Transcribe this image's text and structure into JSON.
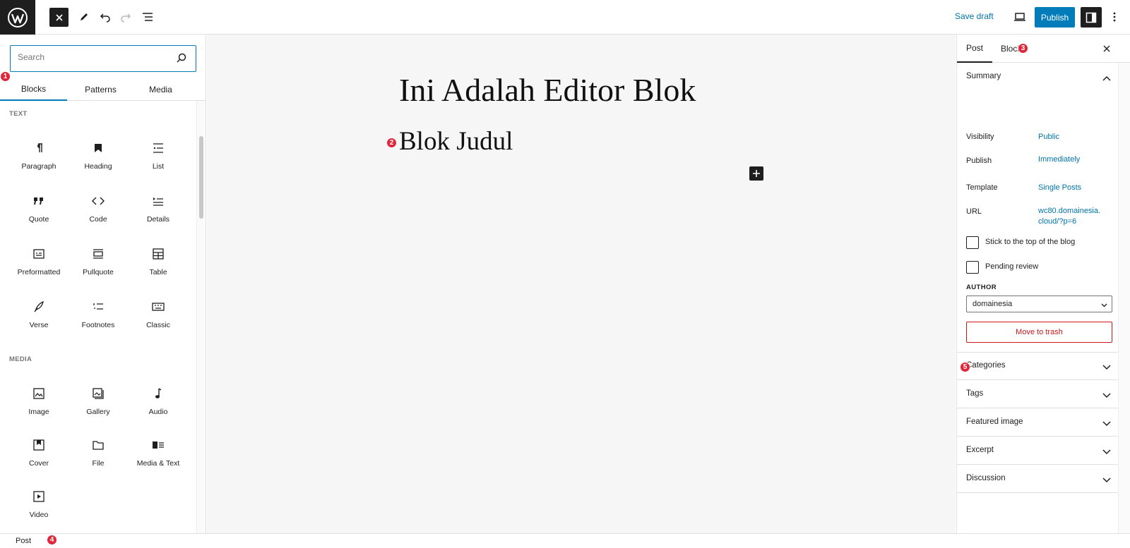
{
  "toolbar": {
    "save_draft": "Save draft",
    "publish": "Publish"
  },
  "inserter": {
    "search_placeholder": "Search",
    "tabs": [
      "Blocks",
      "Patterns",
      "Media"
    ],
    "categories": {
      "text": "TEXT",
      "media": "MEDIA"
    },
    "text_blocks": [
      {
        "label": "Paragraph",
        "icon": "paragraph-icon"
      },
      {
        "label": "Heading",
        "icon": "bookmark-icon"
      },
      {
        "label": "List",
        "icon": "list-icon"
      },
      {
        "label": "Quote",
        "icon": "quote-icon"
      },
      {
        "label": "Code",
        "icon": "code-icon"
      },
      {
        "label": "Details",
        "icon": "details-icon"
      },
      {
        "label": "Preformatted",
        "icon": "preformatted-icon"
      },
      {
        "label": "Pullquote",
        "icon": "pullquote-icon"
      },
      {
        "label": "Table",
        "icon": "table-icon"
      },
      {
        "label": "Verse",
        "icon": "feather-icon"
      },
      {
        "label": "Footnotes",
        "icon": "footnotes-icon"
      },
      {
        "label": "Classic",
        "icon": "keyboard-icon"
      }
    ],
    "media_blocks": [
      {
        "label": "Image",
        "icon": "image-icon"
      },
      {
        "label": "Gallery",
        "icon": "gallery-icon"
      },
      {
        "label": "Audio",
        "icon": "audio-icon"
      },
      {
        "label": "Cover",
        "icon": "cover-icon"
      },
      {
        "label": "File",
        "icon": "folder-icon"
      },
      {
        "label": "Media & Text",
        "icon": "media-text-icon"
      },
      {
        "label": "Video",
        "icon": "video-icon"
      }
    ]
  },
  "editor": {
    "post_title": "Ini Adalah Editor Blok",
    "heading_block": "Blok Judul"
  },
  "sidebar": {
    "tabs": [
      "Post",
      "Block"
    ],
    "summary": {
      "title": "Summary",
      "visibility_label": "Visibility",
      "visibility_value": "Public",
      "publish_label": "Publish",
      "publish_value": "Immediately",
      "template_label": "Template",
      "template_value": "Single Posts",
      "url_label": "URL",
      "url_value": "wc80.domainesia.\ncloud/?p=6",
      "sticky_label": "Stick to the top of the blog",
      "pending_label": "Pending review",
      "author_label": "AUTHOR",
      "author_value": "domainesia",
      "trash": "Move to trash"
    },
    "panels": [
      "Categories",
      "Tags",
      "Featured image",
      "Excerpt",
      "Discussion"
    ]
  },
  "footer": {
    "breadcrumb": "Post"
  },
  "badges": [
    "1",
    "2",
    "3",
    "4",
    "5"
  ],
  "colors": {
    "accent": "#007cba",
    "badge": "#e0263a",
    "danger": "#cc1818",
    "dark": "#1e1e1e"
  }
}
